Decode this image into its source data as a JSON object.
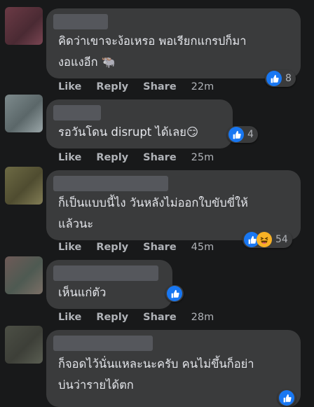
{
  "comments": [
    {
      "text": "คิดว่าเขาจะง้อเหรอ พอเรียกแกรปก็มา\nงอแงอีก 🐃",
      "reaction_count": "8",
      "actions": {
        "like": "Like",
        "reply": "Reply",
        "share": "Share",
        "time": "22m"
      }
    },
    {
      "text": "รอวันโดน disrupt ได้เลย😏",
      "reaction_count": "4",
      "actions": {
        "like": "Like",
        "reply": "Reply",
        "share": "Share",
        "time": "25m"
      }
    },
    {
      "text": "ก็เป็นแบบนี้ไง วันหลังไม่ออกใบขับขี่ให้\nแล้วนะ",
      "reaction_count": "54",
      "actions": {
        "like": "Like",
        "reply": "Reply",
        "share": "Share",
        "time": "45m"
      }
    },
    {
      "text": "เห็นแก่ตัว",
      "reaction_count": "",
      "actions": {
        "like": "Like",
        "reply": "Reply",
        "share": "Share",
        "time": "28m"
      }
    },
    {
      "text": "ก็จอดไว้นั่นแหละนะครับ คนไม่ขึ้นก็อย่า\nบ่นว่ารายได้ตก",
      "reaction_count": "",
      "actions": {}
    }
  ],
  "colors": {
    "background": "#18191a",
    "bubble": "#3a3b3c",
    "like": "#1877f2",
    "haha": "#f7b125"
  }
}
